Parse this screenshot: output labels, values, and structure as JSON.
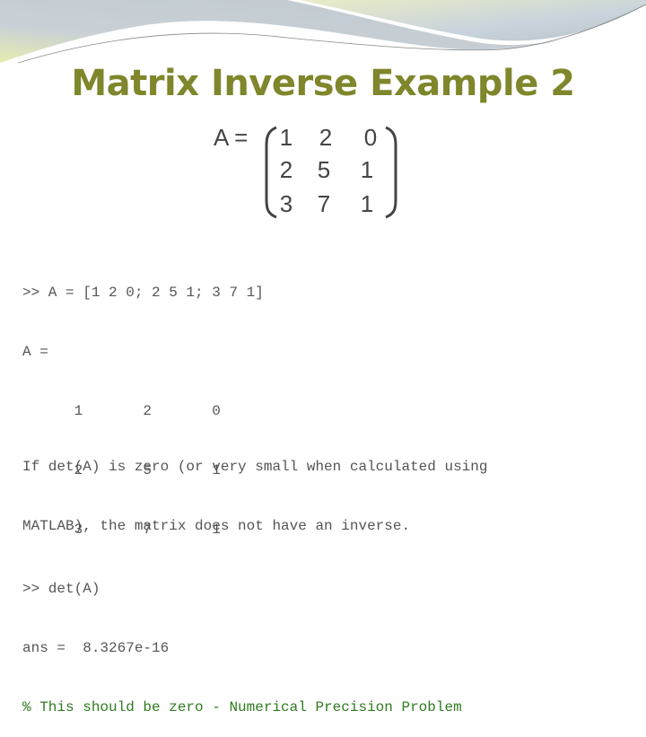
{
  "slide": {
    "title": "Matrix Inverse Example 2",
    "equation_label": "A =",
    "matrix": [
      [
        "1",
        "2",
        "0"
      ],
      [
        "2",
        "5",
        "1"
      ],
      [
        "3",
        "7",
        "1"
      ]
    ],
    "code_lines": [
      ">> A = [1 2 0; 2 5 1; 3 7 1]",
      "A =",
      "      1       2       0",
      "      2       5       1",
      "      3       7       1",
      ">> det(A)",
      "ans =  8.3267e-16"
    ],
    "comment_line": "% This should be zero - Numerical Precision Problem",
    "note_lines": [
      "If det(A) is zero (or very small when calculated using",
      "MATLAB), the matrix does not have an inverse."
    ],
    "colors": {
      "title": "#7f862b",
      "comment": "#2f7a1f",
      "text": "#555555"
    }
  }
}
